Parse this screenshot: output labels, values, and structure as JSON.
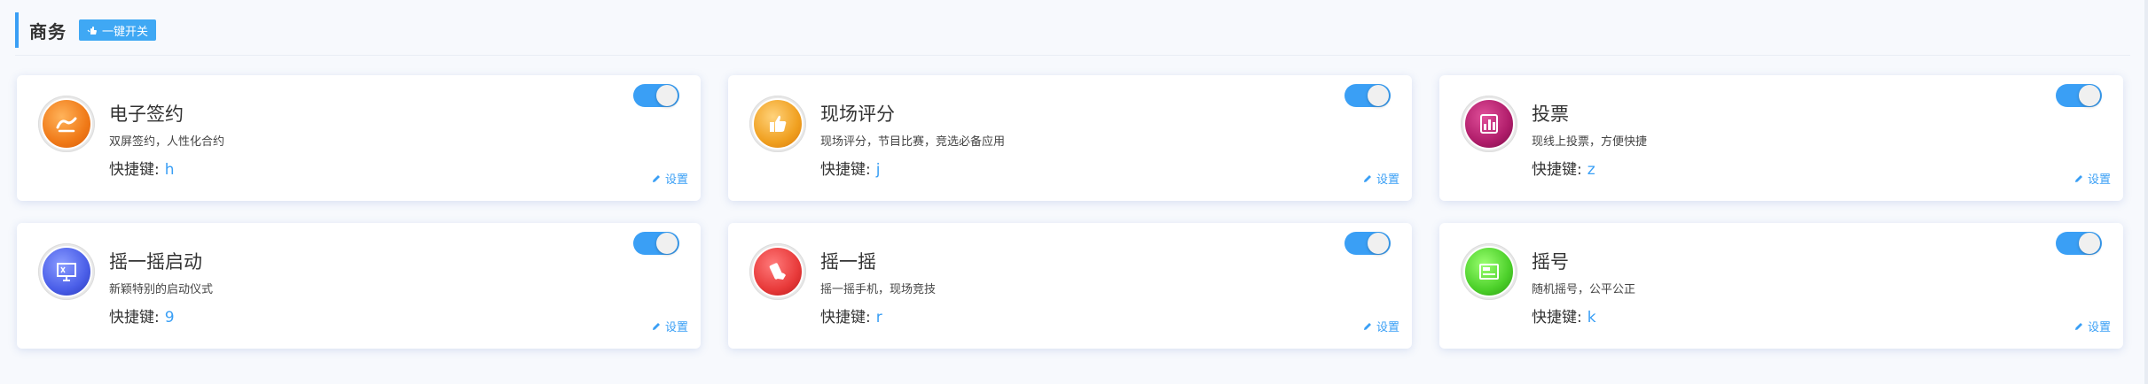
{
  "section": {
    "title": "商务",
    "onekey_label": "一键开关",
    "onekey_icon": "hand-pointer-icon"
  },
  "colors": {
    "accent": "#3a9ff5",
    "toggle_on": "#3a9ff5"
  },
  "cards": [
    {
      "title": "电子签约",
      "desc": "双屏签约，人性化合约",
      "hotkey_label": "快捷键:",
      "hotkey": "h",
      "settings_label": "设置",
      "toggle_on": true,
      "icon": "signature-icon",
      "icon_color": "#f07a18"
    },
    {
      "title": "现场评分",
      "desc": "现场评分，节目比赛，竞选必备应用",
      "hotkey_label": "快捷键:",
      "hotkey": "j",
      "settings_label": "设置",
      "toggle_on": true,
      "icon": "thumbs-up-icon",
      "icon_color": "#f0a020"
    },
    {
      "title": "投票",
      "desc": "现线上投票，方便快捷",
      "hotkey_label": "快捷键:",
      "hotkey": "z",
      "settings_label": "设置",
      "toggle_on": true,
      "icon": "bar-chart-icon",
      "icon_color": "#b01d6a"
    },
    {
      "title": "摇一摇启动",
      "desc": "新颖特别的启动仪式",
      "hotkey_label": "快捷键:",
      "hotkey": "9",
      "settings_label": "设置",
      "toggle_on": true,
      "icon": "presentation-icon",
      "icon_color": "#4a5ee8"
    },
    {
      "title": "摇一摇",
      "desc": "摇一摇手机，现场竞技",
      "hotkey_label": "快捷键:",
      "hotkey": "r",
      "settings_label": "设置",
      "toggle_on": true,
      "icon": "shake-hand-icon",
      "icon_color": "#e83a3a"
    },
    {
      "title": "摇号",
      "desc": "随机摇号，公平公正",
      "hotkey_label": "快捷键:",
      "hotkey": "k",
      "settings_label": "设置",
      "toggle_on": true,
      "icon": "number-display-icon",
      "icon_color": "#4cd02a"
    }
  ]
}
